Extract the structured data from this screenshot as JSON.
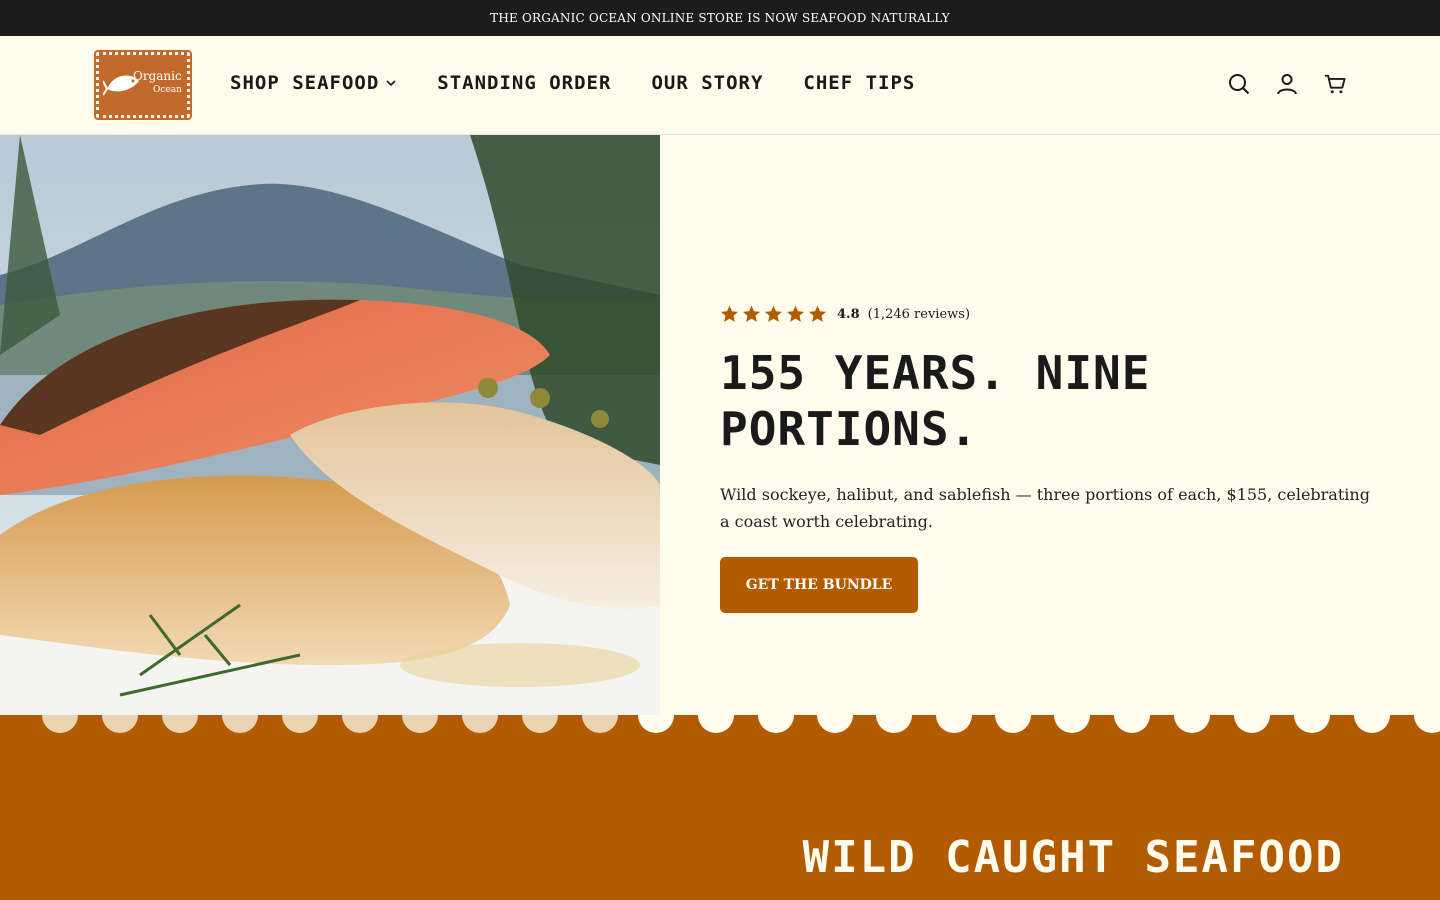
{
  "announcement": "THE ORGANIC OCEAN ONLINE STORE IS NOW SEAFOOD NATURALLY",
  "logo": {
    "line1": "Organic",
    "line2": "Ocean"
  },
  "nav": {
    "items": [
      {
        "label": "SHOP SEAFOOD",
        "has_dropdown": true
      },
      {
        "label": "STANDING ORDER",
        "has_dropdown": false
      },
      {
        "label": "OUR STORY",
        "has_dropdown": false
      },
      {
        "label": "CHEF TIPS",
        "has_dropdown": false
      }
    ]
  },
  "header_icons": [
    "search-icon",
    "account-icon",
    "cart-icon"
  ],
  "hero": {
    "rating": {
      "stars": 5,
      "value": "4.8",
      "count": "(1,246 reviews)"
    },
    "headline": "155 YEARS. NINE PORTIONS.",
    "description": "Wild sockeye, halibut, and sablefish — three portions of each, $155, celebrating a coast worth celebrating.",
    "cta_label": "GET THE BUNDLE"
  },
  "section": {
    "title": "WILD CAUGHT SEAFOOD"
  },
  "colors": {
    "brand": "#b25b00",
    "background": "#fffcee",
    "announcement_bg": "#1c1c1c",
    "logo": "#c26a2b"
  }
}
